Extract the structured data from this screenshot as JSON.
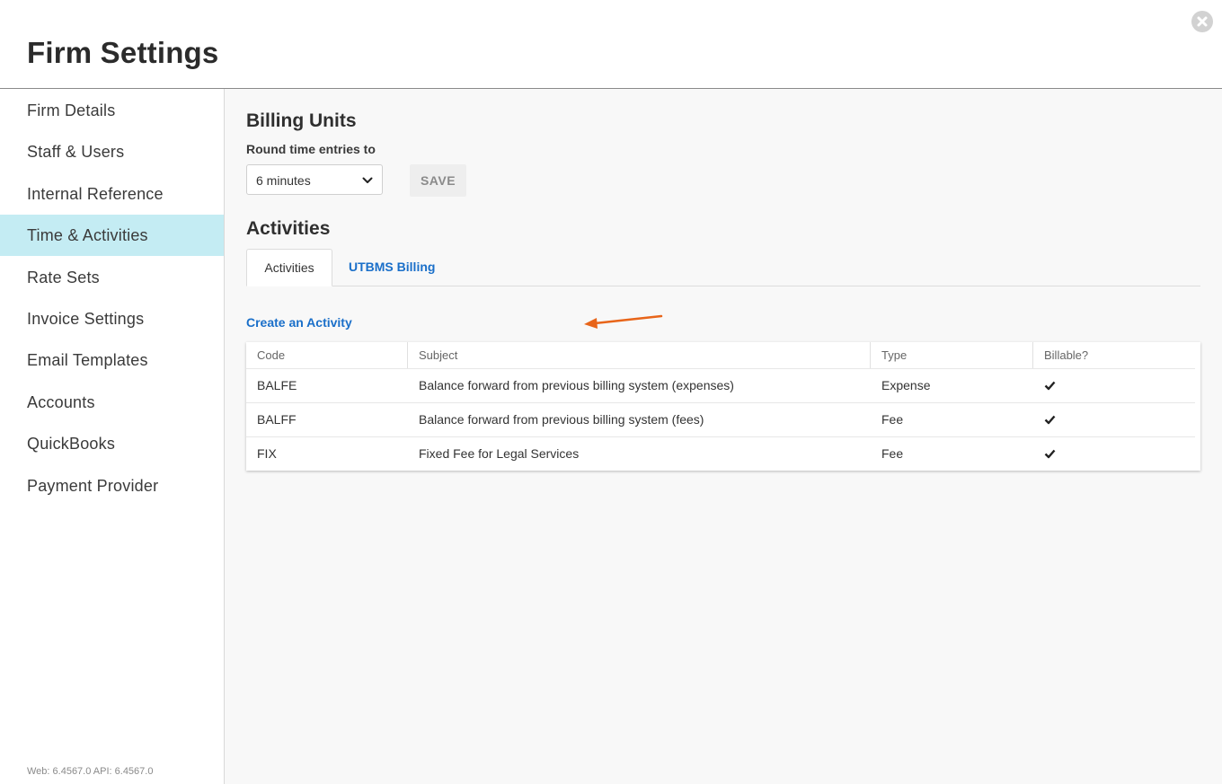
{
  "header": {
    "title": "Firm Settings",
    "close_icon": "close-circle-icon"
  },
  "sidebar": {
    "items": [
      {
        "label": "Firm Details"
      },
      {
        "label": "Staff & Users"
      },
      {
        "label": "Internal Reference"
      },
      {
        "label": "Time & Activities",
        "active": true
      },
      {
        "label": "Rate Sets"
      },
      {
        "label": "Invoice Settings"
      },
      {
        "label": "Email Templates"
      },
      {
        "label": "Accounts"
      },
      {
        "label": "QuickBooks"
      },
      {
        "label": "Payment Provider"
      }
    ],
    "version": "Web: 6.4567.0 API: 6.4567.0",
    "active_color": "#c4ecf3"
  },
  "billing_units": {
    "title": "Billing Units",
    "round_label": "Round time entries to",
    "round_value": "6 minutes",
    "save_label": "SAVE"
  },
  "activities": {
    "title": "Activities",
    "tabs": [
      {
        "label": "Activities",
        "active": true
      },
      {
        "label": "UTBMS Billing",
        "active": false
      }
    ],
    "create_link": "Create an Activity",
    "annotation_color": "#e8651a",
    "table": {
      "columns": [
        "Code",
        "Subject",
        "Type",
        "Billable?"
      ],
      "rows": [
        {
          "code": "BALFE",
          "subject": "Balance forward from previous billing system (expenses)",
          "type": "Expense",
          "billable": true
        },
        {
          "code": "BALFF",
          "subject": "Balance forward from previous billing system (fees)",
          "type": "Fee",
          "billable": true
        },
        {
          "code": "FIX",
          "subject": "Fixed Fee for Legal Services",
          "type": "Fee",
          "billable": true
        }
      ]
    }
  },
  "link_color": "#1a6fc9"
}
